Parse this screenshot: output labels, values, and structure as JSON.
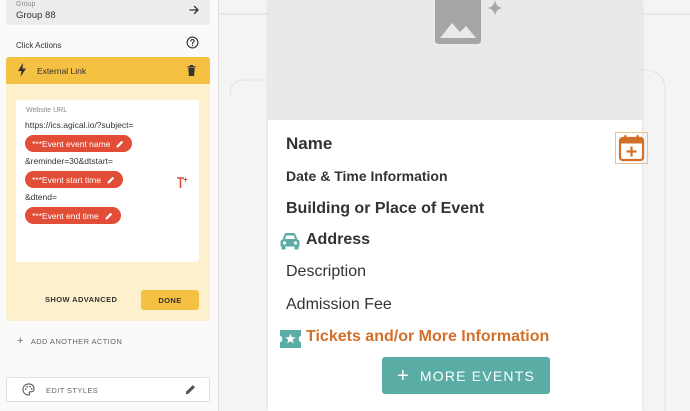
{
  "group": {
    "caption": "Group",
    "value": "Group 88"
  },
  "click_actions": {
    "label": "Click Actions",
    "action": {
      "title": "External Link",
      "url_caption": "Website URL",
      "url_part_1": "https://ics.agical.io/?subject=",
      "pill_1": "***Event event name",
      "url_part_2": "&reminder=30&dtstart=",
      "pill_2": "***Event start time",
      "url_part_3": "&dtend=",
      "pill_3": "***Event end time",
      "show_advanced": "SHOW ADVANCED",
      "done": "DONE"
    },
    "add_another": "ADD ANOTHER ACTION"
  },
  "edit_styles": {
    "label": "EDIT STYLES"
  },
  "event_card": {
    "name": "Name",
    "date": "Date & Time Information",
    "building": "Building or Place of Event",
    "address": "Address",
    "description": "Description",
    "fee": "Admission Fee",
    "tickets": "Tickets and/or More Information",
    "more_events": "MORE EVENTS"
  },
  "colors": {
    "accent_yellow": "#f4c142",
    "pill_red": "#e24d38",
    "teal": "#5aada5",
    "orange": "#d2702b"
  },
  "icons": [
    "arrow-right-icon",
    "help-icon",
    "bolt-icon",
    "trash-icon",
    "pencil-icon",
    "text-insert-icon",
    "plus-icon",
    "palette-icon",
    "image-icon",
    "sparkle-icon",
    "car-icon",
    "ticket-icon",
    "calendar-add-icon"
  ]
}
